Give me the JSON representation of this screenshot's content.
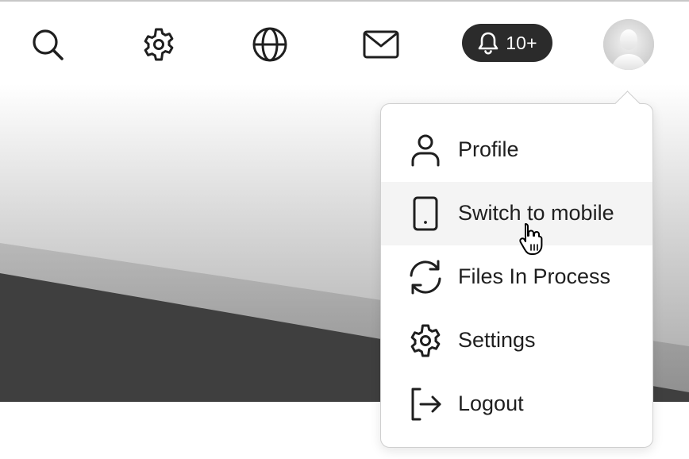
{
  "header": {
    "icons": [
      "search-icon",
      "gear-icon",
      "globe-icon",
      "mail-icon"
    ],
    "notifications": {
      "icon": "bell-icon",
      "count": "10+"
    },
    "avatar": {
      "icon": "user-avatar"
    }
  },
  "menu": {
    "items": [
      {
        "label": "Profile",
        "icon": "person-icon"
      },
      {
        "label": "Switch to mobile",
        "icon": "mobile-icon",
        "hovered": true
      },
      {
        "label": "Files In Process",
        "icon": "refresh-icon"
      },
      {
        "label": "Settings",
        "icon": "gear-icon"
      },
      {
        "label": "Logout",
        "icon": "logout-icon"
      }
    ]
  },
  "colors": {
    "pill_bg": "#2b2b2b",
    "hover_bg": "#f4f4f4",
    "text": "#1f1f1f",
    "banner_dark": "#3f3f3f"
  }
}
